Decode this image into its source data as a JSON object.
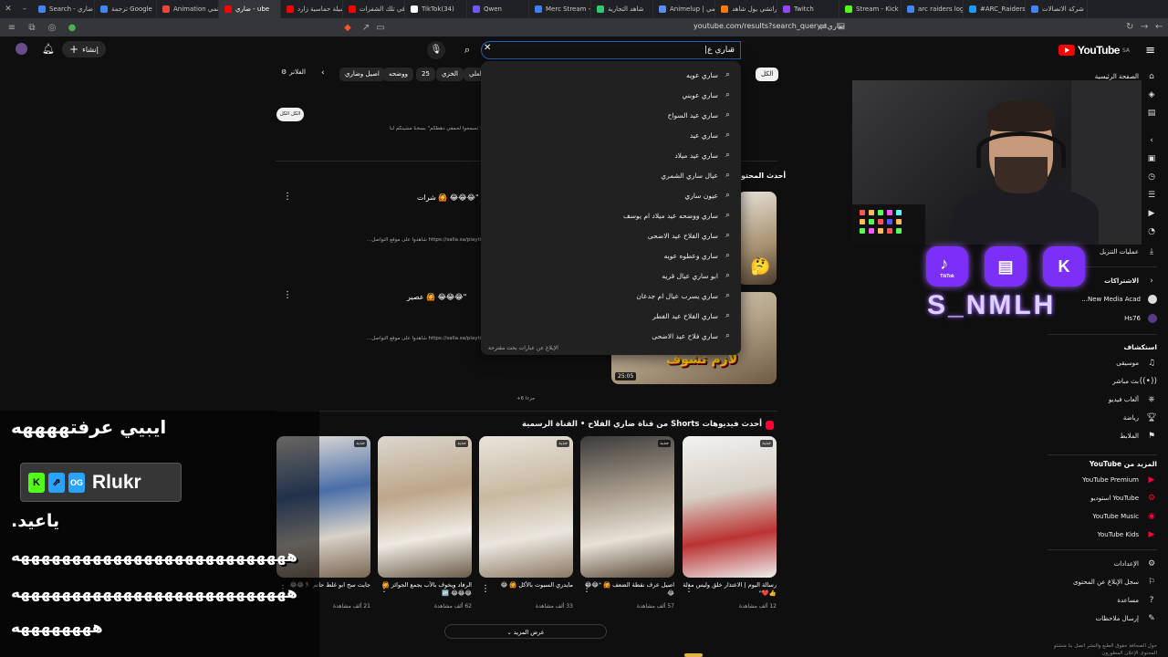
{
  "browser": {
    "tabs": [
      {
        "label": "Search - ضاري",
        "color": "#4285f4"
      },
      {
        "label": "ترجمة Google",
        "color": "#4285f4"
      },
      {
        "label": "Animation انمي",
        "color": "#e8453c"
      },
      {
        "label": "ضاري - ube",
        "color": "#ff0000",
        "active": true
      },
      {
        "label": "شيلة حماسية زارد",
        "color": "#ff0000"
      },
      {
        "label": "في تلك الشفرات",
        "color": "#ff0000"
      },
      {
        "label": "TikTok(34)",
        "color": "#fff"
      },
      {
        "label": "Qwen",
        "color": "#6b5bff"
      },
      {
        "label": "Merc Stream - D",
        "color": "#3b82f6"
      },
      {
        "label": "شاهد التجارية",
        "color": "#2ecc71"
      },
      {
        "label": "Animelup | انمي",
        "color": "#5b8def"
      },
      {
        "label": "كراتشي يول شاهد",
        "color": "#ff7a00"
      },
      {
        "label": "Twitch",
        "color": "#9146ff"
      },
      {
        "label": "Stream - Kick D",
        "color": "#53fc18"
      },
      {
        "label": "arc raiders logo",
        "color": "#4285f4"
      },
      {
        "label": "#ARC_Raiders",
        "color": "#1d9bf0"
      },
      {
        "label": "شركة الاتصالات",
        "color": "#4285f4"
      }
    ],
    "url": "youtube.com/results?search_query=ضاري"
  },
  "header": {
    "logo": "YouTube",
    "region": "SA",
    "search_value": "ساري ع|",
    "create_label": "إنشاء"
  },
  "suggestions": [
    "ساري عويه",
    "ساري عوبني",
    "ساري عيد السواح",
    "ساري عيد",
    "ساري عيد ميلاد",
    "عيال ساري الشمري",
    "عيون ساري",
    "ساري ووضحه عيد ميلاد ام يوسف",
    "ساري الفلاح عيد الاضحى",
    "ساري وعطوه عويه",
    "ابو ساري عيال قريه",
    "ساري يسرب عيال ام جدعان",
    "ساري الفلاح عيد الفطر",
    "ساري فلاح عيد الاضحى"
  ],
  "suggest_report": "الإبلاغ عن عبارات بحث مقترحة",
  "chips": {
    "filters_label": "الفلاتر",
    "items": [
      "الكل",
      "لعلي",
      "الخزي",
      "25",
      "ووضحه",
      "اصيل وضاري"
    ]
  },
  "results": {
    "clear_label": "الكل الكل",
    "note": "لا تسمح تبنية مقطع - \"لا تسمحوا لحمقي دهطكم\" بسخنا مشينكم لنا ...",
    "latest_section": "أحدث المحتو",
    "items": [
      {
        "title": "\"😂😂😂 🙆 شرات",
        "desc": "...شاهدوا على موقع التواصل https://salla.sa/playtime1",
        "duration": "",
        "thumb_text": ""
      },
      {
        "title": "\"😂😂😂 🙆 عصير",
        "desc": "...شاهدوا على موقع التواصل https://salla.sa/playtime1",
        "duration": "25:05",
        "thumb_text": "لازم تشوف"
      }
    ],
    "more_count": "+6 جزءا"
  },
  "shorts": {
    "title": "أحدث فيديوهات Shorts من قناة ضاري الفلاح • القناة الرسمية",
    "items": [
      {
        "caption": "رسالة اليوم | الاعتذار خلق وليس مذلة 👍❤️\"",
        "views": "12 ألف مشاهدة",
        "badge": "جديد"
      },
      {
        "caption": "اصيل عرف نقطة الضعف 🙆 \"😂😂😂",
        "views": "57 ألف مشاهدة",
        "badge": "جديد"
      },
      {
        "caption": "مايدري السبوت بالأكل 🙆 😂",
        "views": "33 ألف مشاهدة",
        "badge": "جديد"
      },
      {
        "caption": "الرفاد ويخوف بالأب يجمع الجوائز 🙆😂😂😂 🆙",
        "views": "62 ألف مشاهدة",
        "badge": "جديد"
      },
      {
        "caption": "جايت سح ابو غلط حاتم 🏃😂😂",
        "views": "21 ألف مشاهدة",
        "badge": "جديد"
      }
    ],
    "more_label": "عرض المزيد"
  },
  "sidebar": {
    "home": "الصفحة الرئيسية",
    "downloads": "عمليات التنزيل",
    "subs_head": "الاشتراكات",
    "subs": [
      "New Media Acad...",
      "Hs76"
    ],
    "explore_head": "استكشاف",
    "explore": [
      "موسيقى",
      "بث مباشر",
      "ألعاب فيديو",
      "رياضة",
      "الملابط"
    ],
    "more_head": "المزيد من YouTube",
    "more": [
      "YouTube Premium",
      "YouTube استوديو",
      "YouTube Music",
      "YouTube Kids"
    ],
    "settings": [
      "الإعدادات",
      "سجل الإبلاغ عن المحتوى",
      "مساعدة",
      "إرسال ملاحظات"
    ],
    "footer": "حول  الصحافة  حقوق الطبع والنشر  اتصل بنا  منشئو المحتوى  الإعلان  المطورون"
  },
  "stream": {
    "name": "S_NMLH",
    "socials": [
      "TikTok",
      "Twitch",
      "Kick"
    ],
    "chat": {
      "line1": "ايبيي عرفتههههه",
      "user": "Rlukr",
      "line2": "ياعيد.",
      "line3": "هههههههههههههههههههههههههههه",
      "line4": "هههههههههههههههههههههههههههه",
      "line5": "ههههههههه"
    }
  }
}
